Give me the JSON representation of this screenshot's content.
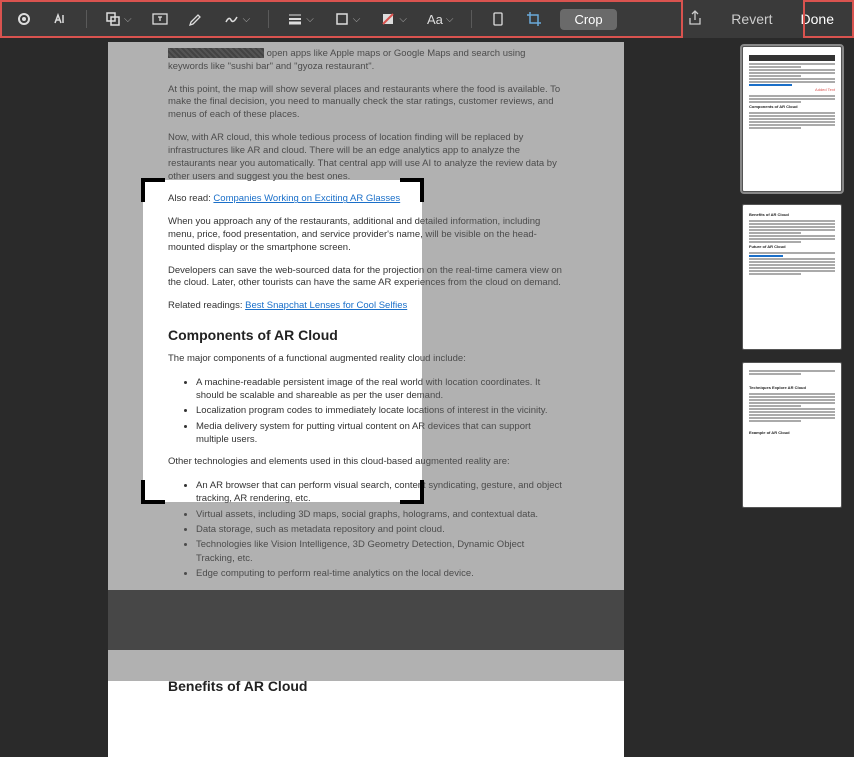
{
  "toolbar": {
    "crop_label": "Crop",
    "revert_label": "Revert",
    "done_label": "Done"
  },
  "document": {
    "p1_part": " open apps like Apple maps or Google Maps and search using keywords like \"sushi bar\" and \"gyoza restaurant\".",
    "p2": "At this point, the map will show several places and restaurants where the food is available. To make the final decision, you need to manually check the star ratings, customer reviews, and menus of each of these places.",
    "p3": "Now, with AR cloud, this whole tedious process of location finding will be replaced by infrastructures like AR and cloud. There will be an edge analytics app to analyze the restaurants near you automatically. That central app will use AI to analyze the review data by other users and suggest you the best ones.",
    "also_read": "Also read: ",
    "link1": "Companies Working on Exciting AR Glasses",
    "p4": "When you approach any of the restaurants, additional and detailed information, including menu, price, food presentation, and service provider's name, will be visible on the head-mounted display or the smartphone screen.",
    "p5": "Developers can save the web-sourced data for the projection on the real-time camera view on the cloud. Later, other tourists can have the same AR experiences from the cloud on demand.",
    "related": "Related readings: ",
    "link2": "Best Snapchat Lenses for Cool Selfies",
    "h_components": "Components of AR Cloud",
    "p6": "The major components of a functional augmented reality cloud include:",
    "list1": [
      "A machine-readable persistent image of the real world with location coordinates. It should be scalable and shareable as per the user demand.",
      "Localization program codes to immediately locate locations of interest in the vicinity.",
      "Media delivery system for putting virtual content on AR devices that can support multiple users."
    ],
    "p7": "Other technologies and elements used in this cloud-based augmented reality are:",
    "list2": [
      "An AR browser that can perform visual search, content syndicating, gesture, and object tracking, AR rendering, etc.",
      "Virtual assets, including 3D maps, social graphs, holograms, and contextual data.",
      "Data storage, such as metadata repository and point cloud.",
      "Technologies like Vision Intelligence, 3D Geometry Detection, Dynamic Object Tracking, etc.",
      "Edge computing to perform real-time analytics on the local device."
    ],
    "h_benefits": "Benefits of AR Cloud"
  },
  "thumbs": {
    "t1_red": "Added Text",
    "t2_h1": "Benefits of AR Cloud",
    "t2_h2": "Future of AR Cloud",
    "t3_h1": "Techniques Explore AR Cloud",
    "t3_h2": "Example of AR Cloud"
  }
}
